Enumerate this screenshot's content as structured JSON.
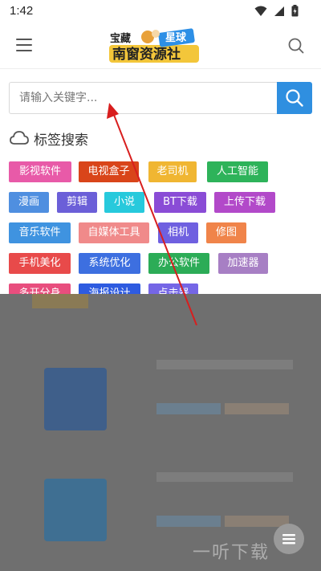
{
  "status_bar": {
    "time": "1:42"
  },
  "header": {
    "logo_text_main": "南窗资源社",
    "logo_text_left": "宝藏",
    "logo_text_right": "星球"
  },
  "search": {
    "placeholder": "请输入关键字..."
  },
  "tags_section": {
    "title": "标签搜索",
    "tags": [
      {
        "label": "影视软件",
        "color": "#e85aa8"
      },
      {
        "label": "电视盒子",
        "color": "#d9451a"
      },
      {
        "label": "老司机",
        "color": "#f0b632"
      },
      {
        "label": "人工智能",
        "color": "#2eb35a"
      },
      {
        "label": "漫画",
        "color": "#4f8fe0"
      },
      {
        "label": "剪辑",
        "color": "#6b5fd8"
      },
      {
        "label": "小说",
        "color": "#27c9dc"
      },
      {
        "label": "BT下载",
        "color": "#8a4cd6"
      },
      {
        "label": "上传下载",
        "color": "#b249c9"
      },
      {
        "label": "音乐软件",
        "color": "#3f93e0"
      },
      {
        "label": "自媒体工具",
        "color": "#f08a8a"
      },
      {
        "label": "相机",
        "color": "#6f60e0"
      },
      {
        "label": "修图",
        "color": "#f0844a"
      },
      {
        "label": "手机美化",
        "color": "#e84a4a"
      },
      {
        "label": "系统优化",
        "color": "#3d6fe0"
      },
      {
        "label": "办公软件",
        "color": "#2cac57"
      },
      {
        "label": "加速器",
        "color": "#a77fc4"
      },
      {
        "label": "多开分身",
        "color": "#e84e7e"
      },
      {
        "label": "海报设计",
        "color": "#2e5be0"
      },
      {
        "label": "点击器",
        "color": "#7566e6"
      }
    ]
  },
  "watermark": "一听下载",
  "icons": {
    "menu": "hamburger-menu-icon",
    "search": "search-icon",
    "cloud": "cloud-icon",
    "fab": "list-menu-icon"
  }
}
